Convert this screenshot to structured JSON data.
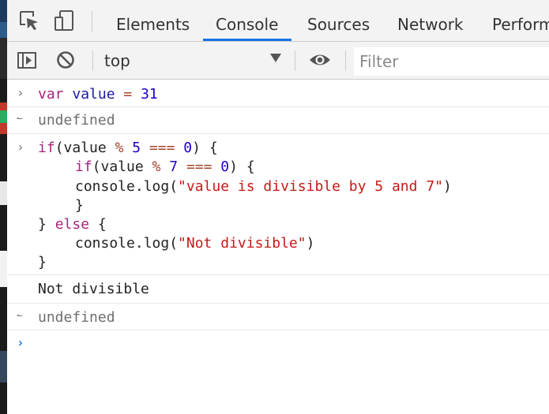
{
  "tabs": [
    {
      "label": "Elements"
    },
    {
      "label": "Console"
    },
    {
      "label": "Sources"
    },
    {
      "label": "Network"
    },
    {
      "label": "Perform"
    }
  ],
  "active_tab": "Console",
  "toolbar": {
    "context": "top",
    "filter_placeholder": "Filter"
  },
  "console": {
    "entry1": {
      "kw": "var",
      "name": "value",
      "eq": "=",
      "num": "31"
    },
    "result1": "undefined",
    "block": {
      "l1_kw": "if",
      "l1_a": "(",
      "l1_var": "value",
      "l1_mod": "%",
      "l1_n": "5",
      "l1_eq": "===",
      "l1_z": "0",
      "l1_b": ") {",
      "l2_kw": "if",
      "l2_a": "(",
      "l2_var": "value",
      "l2_mod": "%",
      "l2_n": "7",
      "l2_eq": "===",
      "l2_z": "0",
      "l2_b": ") {",
      "l3_fn": "console.log(",
      "l3_str": "\"value is divisible by 5 and 7\"",
      "l3_end": ")",
      "l4": "}",
      "l5_a": "}",
      "l5_kw": "else",
      "l5_b": "{",
      "l6_fn": "console.log(",
      "l6_str": "\"Not divisible\"",
      "l6_end": ")",
      "l7": "}"
    },
    "log_output": "Not divisible",
    "result2": "undefined"
  }
}
